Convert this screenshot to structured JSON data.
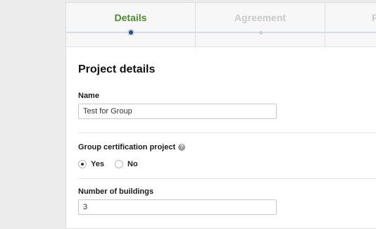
{
  "steps": [
    {
      "label": "Details",
      "state": "active"
    },
    {
      "label": "Agreement",
      "state": "inactive"
    },
    {
      "label": "F",
      "state": "inactive"
    }
  ],
  "form": {
    "title": "Project details",
    "name_label": "Name",
    "name_value": "Test for Group",
    "group_label": "Group certification project",
    "help_icon": "?",
    "group_options": [
      {
        "label": "Yes",
        "checked": true
      },
      {
        "label": "No",
        "checked": false
      }
    ],
    "buildings_label": "Number of buildings",
    "buildings_value": "3"
  },
  "colors": {
    "active_step": "#4c8a2e",
    "inactive_step": "#c9c9c9",
    "active_dot": "#2c4f7c"
  }
}
